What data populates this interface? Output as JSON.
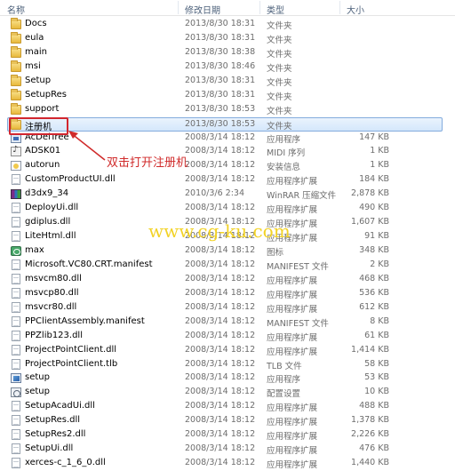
{
  "columns": [
    "名称",
    "修改日期",
    "类型",
    "大小"
  ],
  "rows": [
    {
      "name": "Docs",
      "date": "2013/8/30 18:31",
      "type": "文件夹",
      "size": "",
      "icon": "folder-icon"
    },
    {
      "name": "eula",
      "date": "2013/8/30 18:31",
      "type": "文件夹",
      "size": "",
      "icon": "folder-icon"
    },
    {
      "name": "main",
      "date": "2013/8/30 18:38",
      "type": "文件夹",
      "size": "",
      "icon": "folder-icon"
    },
    {
      "name": "msi",
      "date": "2013/8/30 18:46",
      "type": "文件夹",
      "size": "",
      "icon": "folder-icon"
    },
    {
      "name": "Setup",
      "date": "2013/8/30 18:31",
      "type": "文件夹",
      "size": "",
      "icon": "folder-icon"
    },
    {
      "name": "SetupRes",
      "date": "2013/8/30 18:31",
      "type": "文件夹",
      "size": "",
      "icon": "folder-icon"
    },
    {
      "name": "support",
      "date": "2013/8/30 18:53",
      "type": "文件夹",
      "size": "",
      "icon": "folder-icon"
    },
    {
      "name": "注册机",
      "date": "2013/8/30 18:53",
      "type": "文件夹",
      "size": "",
      "icon": "folder-icon",
      "selected": true
    },
    {
      "name": "AcDelTree",
      "date": "2008/3/14 18:12",
      "type": "应用程序",
      "size": "147 KB",
      "icon": "exe-icon"
    },
    {
      "name": "ADSK01",
      "date": "2008/3/14 18:12",
      "type": "MIDI 序列",
      "size": "1 KB",
      "icon": "midi-icon"
    },
    {
      "name": "autorun",
      "date": "2008/3/14 18:12",
      "type": "安装信息",
      "size": "1 KB",
      "icon": "inf-icon"
    },
    {
      "name": "CustomProductUI.dll",
      "date": "2008/3/14 18:12",
      "type": "应用程序扩展",
      "size": "184 KB",
      "icon": "dll-icon"
    },
    {
      "name": "d3dx9_34",
      "date": "2010/3/6 2:34",
      "type": "WinRAR 压缩文件",
      "size": "2,878 KB",
      "icon": "rar-icon"
    },
    {
      "name": "DeployUi.dll",
      "date": "2008/3/14 18:12",
      "type": "应用程序扩展",
      "size": "490 KB",
      "icon": "dll-icon"
    },
    {
      "name": "gdiplus.dll",
      "date": "2008/3/14 18:12",
      "type": "应用程序扩展",
      "size": "1,607 KB",
      "icon": "dll-icon"
    },
    {
      "name": "LiteHtml.dll",
      "date": "2008/3/14 18:12",
      "type": "应用程序扩展",
      "size": "91 KB",
      "icon": "dll-icon"
    },
    {
      "name": "max",
      "date": "2008/3/14 18:12",
      "type": "图标",
      "size": "348 KB",
      "icon": "image-icon"
    },
    {
      "name": "Microsoft.VC80.CRT.manifest",
      "date": "2008/3/14 18:12",
      "type": "MANIFEST 文件",
      "size": "2 KB",
      "icon": "file-icon"
    },
    {
      "name": "msvcm80.dll",
      "date": "2008/3/14 18:12",
      "type": "应用程序扩展",
      "size": "468 KB",
      "icon": "dll-icon"
    },
    {
      "name": "msvcp80.dll",
      "date": "2008/3/14 18:12",
      "type": "应用程序扩展",
      "size": "536 KB",
      "icon": "dll-icon"
    },
    {
      "name": "msvcr80.dll",
      "date": "2008/3/14 18:12",
      "type": "应用程序扩展",
      "size": "612 KB",
      "icon": "dll-icon"
    },
    {
      "name": "PPClientAssembly.manifest",
      "date": "2008/3/14 18:12",
      "type": "MANIFEST 文件",
      "size": "8 KB",
      "icon": "file-icon"
    },
    {
      "name": "PPZlib123.dll",
      "date": "2008/3/14 18:12",
      "type": "应用程序扩展",
      "size": "61 KB",
      "icon": "dll-icon"
    },
    {
      "name": "ProjectPointClient.dll",
      "date": "2008/3/14 18:12",
      "type": "应用程序扩展",
      "size": "1,414 KB",
      "icon": "dll-icon"
    },
    {
      "name": "ProjectPointClient.tlb",
      "date": "2008/3/14 18:12",
      "type": "TLB 文件",
      "size": "58 KB",
      "icon": "file-icon"
    },
    {
      "name": "setup",
      "date": "2008/3/14 18:12",
      "type": "应用程序",
      "size": "53 KB",
      "icon": "setup-icon"
    },
    {
      "name": "setup",
      "date": "2008/3/14 18:12",
      "type": "配置设置",
      "size": "10 KB",
      "icon": "config-icon"
    },
    {
      "name": "SetupAcadUi.dll",
      "date": "2008/3/14 18:12",
      "type": "应用程序扩展",
      "size": "488 KB",
      "icon": "dll-icon"
    },
    {
      "name": "SetupRes.dll",
      "date": "2008/3/14 18:12",
      "type": "应用程序扩展",
      "size": "1,378 KB",
      "icon": "dll-icon"
    },
    {
      "name": "SetupRes2.dll",
      "date": "2008/3/14 18:12",
      "type": "应用程序扩展",
      "size": "2,226 KB",
      "icon": "dll-icon"
    },
    {
      "name": "SetupUi.dll",
      "date": "2008/3/14 18:12",
      "type": "应用程序扩展",
      "size": "476 KB",
      "icon": "dll-icon"
    },
    {
      "name": "xerces-c_1_6_0.dll",
      "date": "2008/3/14 18:12",
      "type": "应用程序扩展",
      "size": "1,440 KB",
      "icon": "dll-icon"
    }
  ],
  "annotation": "双击打开注册机",
  "watermark": "www.cg-ku.com",
  "colors": {
    "annotation": "#d02a2a",
    "selection_border": "#84acdd",
    "highlight_box": "#d2262e",
    "watermark": "#f2d226"
  }
}
